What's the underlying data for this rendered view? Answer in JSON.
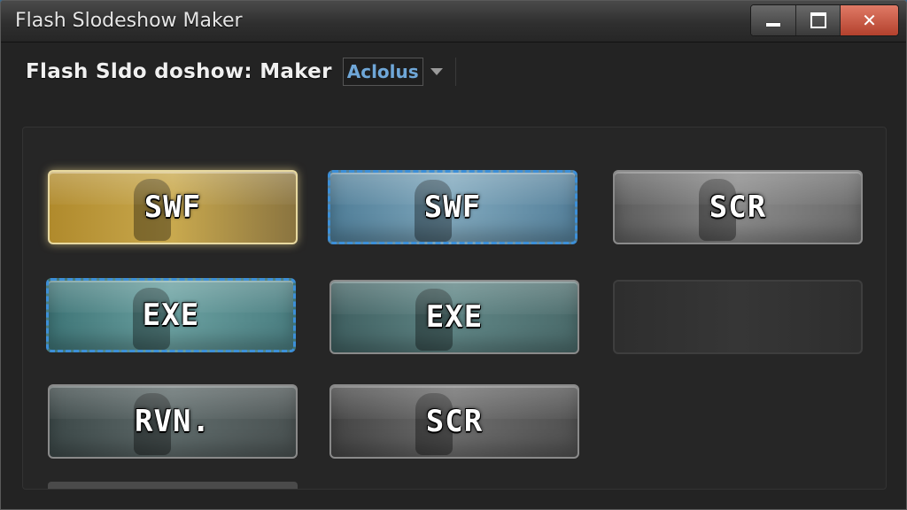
{
  "window": {
    "title": "Flash Slodeshow Maker",
    "controls": {
      "minimize": "",
      "maximize": "",
      "close": "✕"
    }
  },
  "header": {
    "app_label": "Flash Sldo doshow: Maker",
    "dropdown_value": "Aclolus"
  },
  "tiles": [
    {
      "label": "SWF",
      "style": "gold",
      "state": "selected"
    },
    {
      "label": "SWF",
      "style": "blue",
      "state": "focused"
    },
    {
      "label": "SCR",
      "style": "grey",
      "state": "normal"
    },
    {
      "label": "EXE",
      "style": "teal",
      "state": "focused"
    },
    {
      "label": "EXE",
      "style": "teal2",
      "state": "normal"
    },
    {
      "label": "",
      "style": "dim",
      "state": "disabled"
    },
    {
      "label": "RVN.",
      "style": "slate",
      "state": "normal"
    },
    {
      "label": "SCR",
      "style": "slate2",
      "state": "normal"
    }
  ],
  "colors": {
    "accent_blue": "#3c8fd8",
    "dropdown_text": "#6fa7d8",
    "close_button": "#c9533c",
    "selected_glow": "#e8d9a0"
  }
}
